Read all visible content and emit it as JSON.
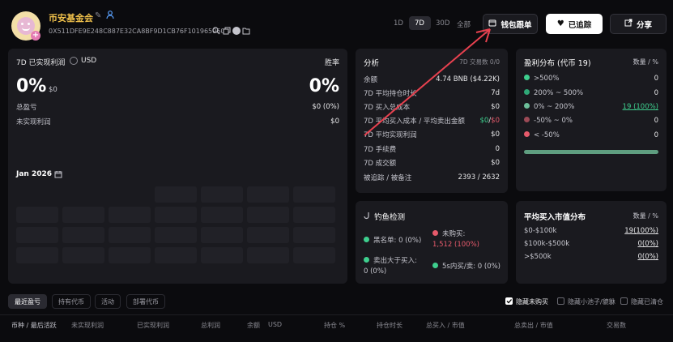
{
  "header": {
    "wallet_name": "币安基金会",
    "address": "0X511DFE9E248C887E32CA8BF9D1CB76F101965060",
    "periods": [
      "1D",
      "7D",
      "30D",
      "全部"
    ],
    "active_period": "7D",
    "copy_wallet_label": "钱包跟单",
    "following_label": "已追踪",
    "share_label": "分享"
  },
  "pnl_card": {
    "title": "7D 已实现利润",
    "currency": "USD",
    "winrate_label": "胜率",
    "pnl_value": "0%",
    "pnl_usd": "$0",
    "winrate_value": "0%",
    "total_pnl_label": "总盈亏",
    "total_pnl_value": "$0 (0%)",
    "unrealized_label": "未实现利润",
    "unrealized_value": "$0",
    "calendar_month": "Jan 2026"
  },
  "analysis": {
    "title": "分析",
    "trades_label": "7D 交易数 0/0",
    "rows": [
      {
        "label": "余额",
        "value": "4.74 BNB ($4.22K)"
      },
      {
        "label": "7D 平均持仓时长",
        "value": "7d"
      },
      {
        "label": "7D 买入总成本",
        "value": "$0"
      },
      {
        "label": "7D 平均买入成本 / 平均卖出金额",
        "value_green": "$0",
        "value_sep": "/",
        "value_red": "$0"
      },
      {
        "label": "7D 平均实现利润",
        "value": "$0"
      },
      {
        "label": "7D 手续费",
        "value": "0"
      },
      {
        "label": "7D 成交额",
        "value": "$0"
      },
      {
        "label": "被追踪 / 被备注",
        "value": "2393 / 2632"
      }
    ]
  },
  "phishing": {
    "title": "钓鱼检测",
    "blacklist_label": "黑名单: 0 (0%)",
    "unbought_label": "未购买:",
    "unbought_value": "1,512 (100%)",
    "sold_more_label": "卖出大于买入:",
    "sold_more_value": "0 (0%)",
    "fast_trade_label": "5s内买/卖: 0 (0%)"
  },
  "profit_distribution": {
    "title": "盈利分布 (代币 19)",
    "header_right": "数量 / %",
    "rows": [
      {
        "label": ">500%",
        "value": "0",
        "color": "#3ecf8e"
      },
      {
        "label": "200% ~ 500%",
        "value": "0",
        "color": "#2fa877"
      },
      {
        "label": "0% ~ 200%",
        "value": "19 (100%)",
        "color": "#6dbf9a"
      },
      {
        "label": "-50% ~ 0%",
        "value": "0",
        "color": "#9c4a56"
      },
      {
        "label": "< -50%",
        "value": "0",
        "color": "#e65a6b"
      }
    ]
  },
  "mcap_distribution": {
    "title": "平均买入市值分布",
    "header_right": "数量 / %",
    "rows": [
      {
        "label": "$0-$100k",
        "value": "19(100%)"
      },
      {
        "label": "$100k-$500k",
        "value": "0(0%)"
      },
      {
        "label": ">$500k",
        "value": "0(0%)"
      }
    ]
  },
  "tabs": [
    "最近盈亏",
    "持有代币",
    "活动",
    "部署代币"
  ],
  "filters": [
    "隐藏未购买",
    "隐藏小池子/貔貅",
    "隐藏已清仓"
  ],
  "table_headers": [
    "币种 / 最后活跃",
    "未实现利润",
    "已实现利润",
    "总利润",
    "余额",
    "USD",
    "持仓 %",
    "持仓时长",
    "总买入 / 市值",
    "总卖出 / 市值",
    "交易数"
  ],
  "colors": {
    "accent_green": "#3ecf8e",
    "accent_red": "#e65a6b",
    "avatar": "#f3dfa8",
    "wallet_name": "#f0c14b",
    "annotation_arrow": "#e8414f"
  }
}
